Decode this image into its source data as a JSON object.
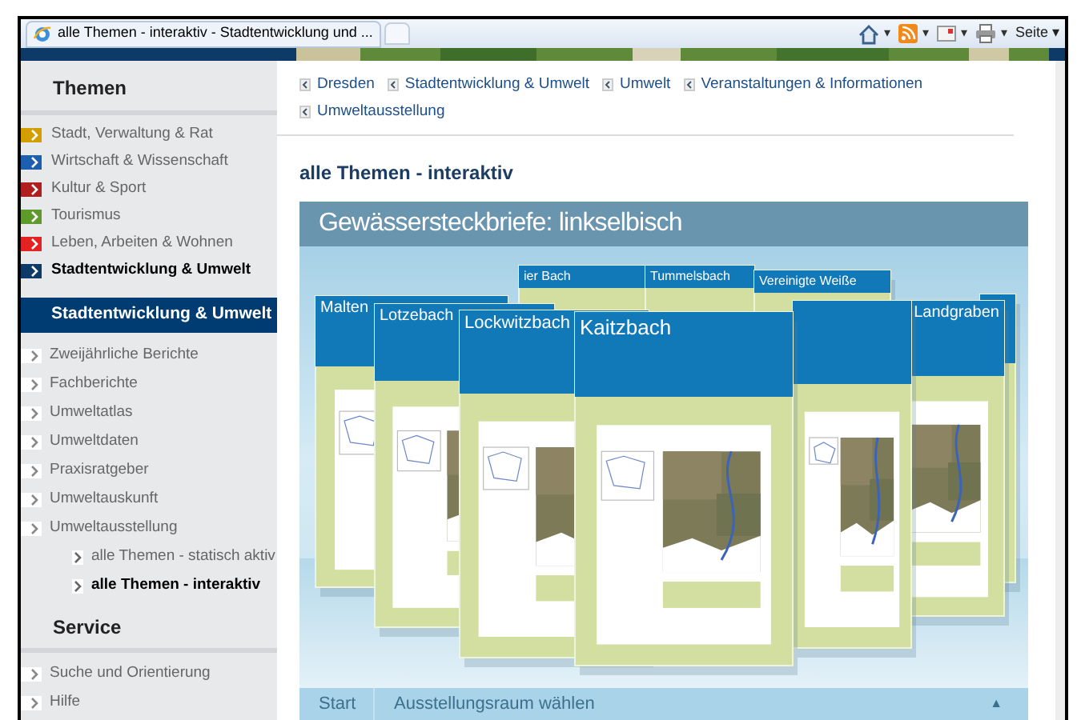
{
  "browser": {
    "tab_title": "alle Themen - interaktiv - Stadtentwicklung und ...",
    "toolbar": [
      {
        "kind": "home",
        "caret": "▾"
      },
      {
        "kind": "feed",
        "caret": "▾"
      },
      {
        "kind": "mail",
        "caret": "▾"
      },
      {
        "kind": "print",
        "caret": "▾"
      }
    ],
    "page_menu": {
      "label": "Seite",
      "caret": "▾"
    }
  },
  "sidebar": {
    "themes_heading": "Themen",
    "themes": [
      {
        "label": "Stadt, Verwaltung & Rat",
        "color": "#d39e00",
        "selected": false
      },
      {
        "label": "Wirtschaft & Wissenschaft",
        "color": "#1b5fae",
        "selected": false
      },
      {
        "label": "Kultur & Sport",
        "color": "#b01e1e",
        "selected": false
      },
      {
        "label": "Tourismus",
        "color": "#5f9b2c",
        "selected": false
      },
      {
        "label": "Leben, Arbeiten & Wohnen",
        "color": "#e32222",
        "selected": false
      },
      {
        "label": "Stadtentwicklung & Umwelt",
        "color": "#0e3a68",
        "selected": true
      }
    ],
    "section_heading": "Stadtentwicklung & Umwelt",
    "items": [
      {
        "label": "Zweijährliche Berichte",
        "selected": false
      },
      {
        "label": "Fachberichte",
        "selected": false
      },
      {
        "label": "Umweltatlas",
        "selected": false
      },
      {
        "label": "Umweltdaten",
        "selected": false
      },
      {
        "label": "Praxisratgeber",
        "selected": false
      },
      {
        "label": "Umweltauskunft",
        "selected": false
      },
      {
        "label": "Umweltausstellung",
        "selected": false,
        "children": [
          {
            "label": "alle Themen - statisch aktiv",
            "selected": false
          },
          {
            "label": "alle Themen - interaktiv",
            "selected": true
          }
        ]
      }
    ],
    "service_heading": "Service",
    "service_items": [
      {
        "label": "Suche und Orientierung"
      },
      {
        "label": "Hilfe"
      }
    ]
  },
  "breadcrumbs": [
    "Dresden",
    "Stadtentwicklung & Umwelt",
    "Umwelt",
    "Veranstaltungen & Informationen",
    "Umweltausstellung"
  ],
  "page_title": "alle Themen - interaktiv",
  "gallery": {
    "title": "Gewässersteckbriefe: linkselbisch",
    "cards": [
      {
        "title": "ier Bach"
      },
      {
        "title": "Tummelsbach"
      },
      {
        "title": "Vereinigte Weiße"
      },
      {
        "title": "Malten"
      },
      {
        "title": "Lotzebach"
      },
      {
        "title": "Lockwitzbach"
      },
      {
        "title": "Kaitzbach"
      },
      {
        "title": "Landgraben"
      }
    ],
    "start": "Start",
    "room_select": "Ausstellungsraum wählen",
    "room_caret": "▲"
  }
}
